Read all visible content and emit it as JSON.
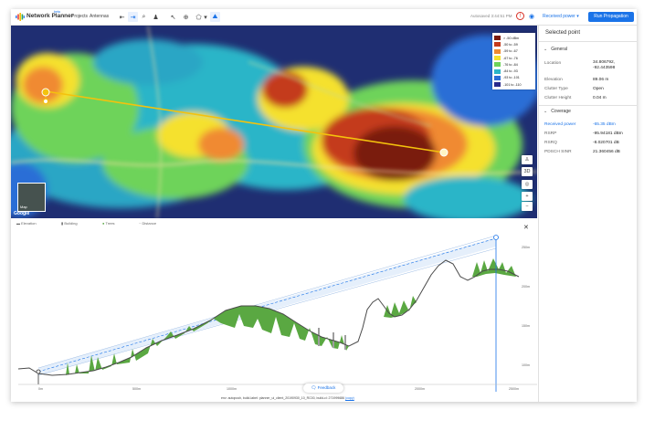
{
  "app": {
    "brand": "Network Planner",
    "badge": "beta",
    "nav": [
      "Projects",
      "Antennas"
    ],
    "autosave": "Autosaved 3:44:51 PM",
    "warning_glyph": "!",
    "metric_select": "Received power",
    "run_button": "Run Propagation"
  },
  "colors": {
    "accent": "#1a73e8",
    "link_line": "#f4c20d",
    "terrain": "#4a4a4a",
    "trees": "#5aa842",
    "buildings": "#9e9e9e"
  },
  "map": {
    "legend": [
      {
        "label": "> -50 dBm",
        "color": "#7a1a0d"
      },
      {
        "label": "-50 to -59",
        "color": "#c43a1c"
      },
      {
        "label": "-59 to -67",
        "color": "#f08a30"
      },
      {
        "label": "-67 to -76",
        "color": "#f5e12e"
      },
      {
        "label": "-76 to -84",
        "color": "#6ed35a"
      },
      {
        "label": "-84 to -93",
        "color": "#2bb5c8"
      },
      {
        "label": "-93 to -101",
        "color": "#2b6ed6"
      },
      {
        "label": "-101 to -110",
        "color": "#2a2a8c"
      }
    ],
    "controls": {
      "three_d": "3D",
      "zoom_in": "+",
      "zoom_out": "−"
    },
    "thumb_label": "Map",
    "attribution": "Google"
  },
  "profile": {
    "legend": [
      "Elevation",
      "Building",
      "Trees",
      "Distance"
    ],
    "x_ticks": [
      "0m",
      "500m",
      "1000m",
      "1500m",
      "2000m",
      "2500m"
    ],
    "y_ticks": [
      "250m",
      "200m",
      "150m",
      "100m"
    ],
    "feedback": "Feedback",
    "build_info": "env: autopush, build-label: planner_ui_client_20190930_10_RC00, build-cl: 271999686 ",
    "copy_link": "(copy)"
  },
  "panel": {
    "title": "Selected point",
    "general": {
      "header": "General",
      "rows": [
        {
          "label": "Location",
          "value": "34.806792, -92.443598"
        },
        {
          "label": "Elevation",
          "value": "89.06 m"
        },
        {
          "label": "Clutter Type",
          "value": "Open"
        },
        {
          "label": "Clutter Height",
          "value": "0.04 m"
        }
      ]
    },
    "coverage": {
      "header": "Coverage",
      "rows": [
        {
          "label": "Received power",
          "value": "-65.35 dBm"
        },
        {
          "label": "RSRP",
          "value": "-95.94181 dBm"
        },
        {
          "label": "RSRQ",
          "value": "-8.020701 dB"
        },
        {
          "label": "PDSCH SINR",
          "value": "21.360456 dB"
        }
      ]
    }
  }
}
